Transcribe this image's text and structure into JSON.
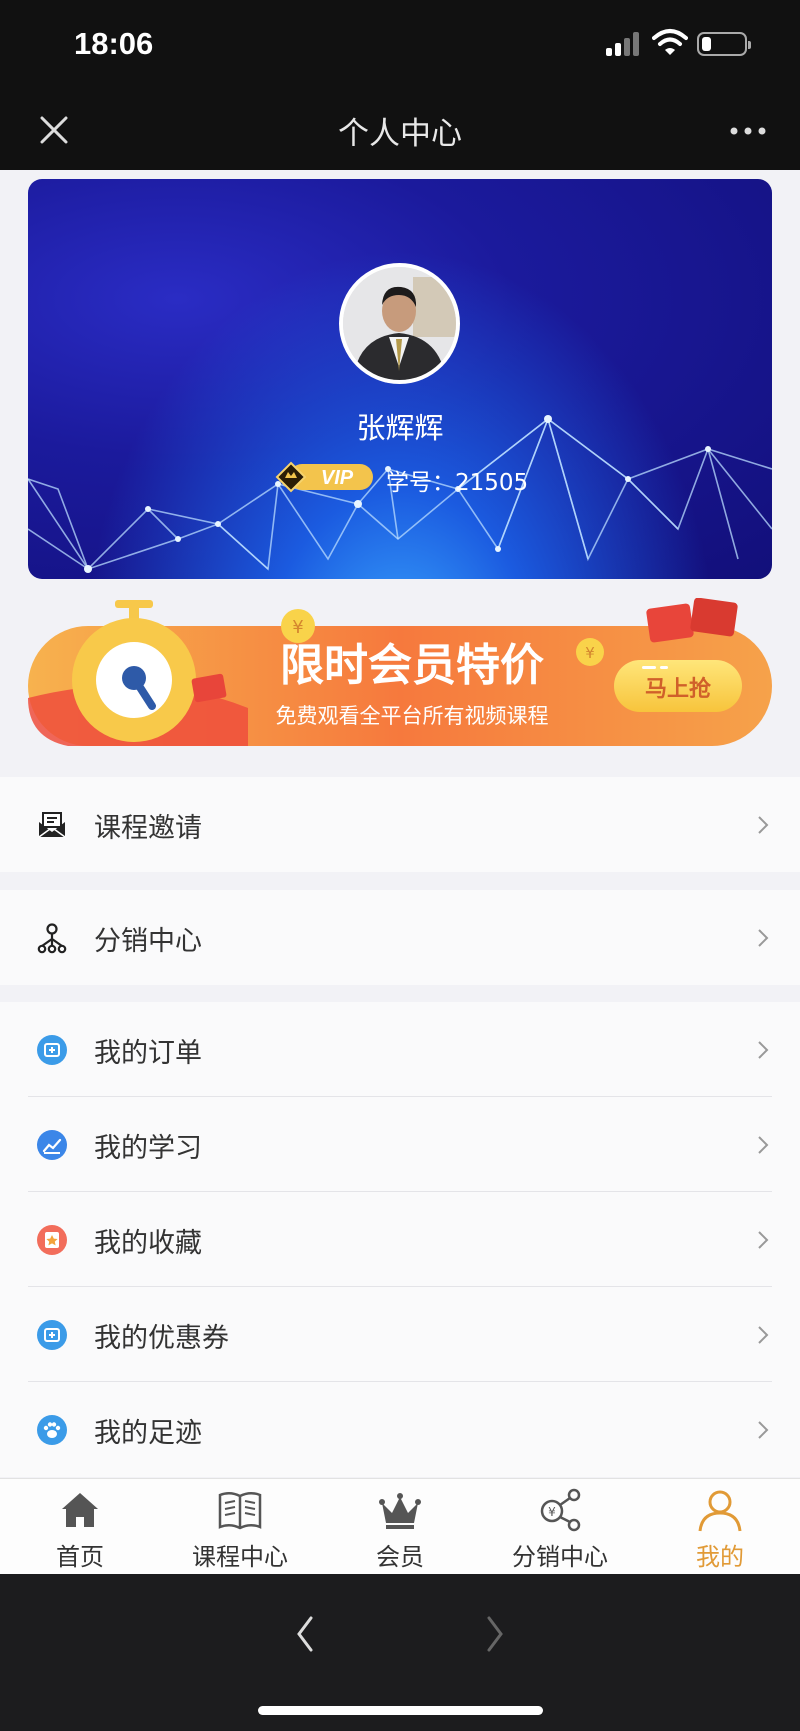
{
  "status_bar": {
    "time": "18:06"
  },
  "nav": {
    "title": "个人中心"
  },
  "profile": {
    "name": "张辉辉",
    "vip_text": "VIP",
    "student_id": "学号：21505"
  },
  "promo": {
    "title": "限时会员特价",
    "subtitle": "免费观看全平台所有视频课程",
    "button": "马上抢",
    "coin_symbol": "¥"
  },
  "menu": {
    "invite": "课程邀请",
    "distribution": "分销中心",
    "orders": "我的订单",
    "learning": "我的学习",
    "favorites": "我的收藏",
    "coupons": "我的优惠券",
    "footprints": "我的足迹"
  },
  "tabs": {
    "home": "首页",
    "courses": "课程中心",
    "member": "会员",
    "distribution": "分销中心",
    "mine": "我的"
  },
  "colors": {
    "accent": "#e19a36",
    "orange": "#f4753a",
    "banner_blue": "#1b1a9c"
  }
}
